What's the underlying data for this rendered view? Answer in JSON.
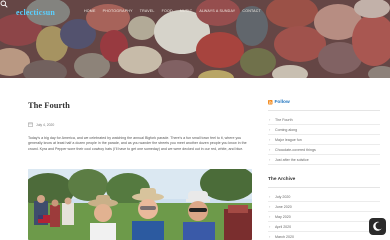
{
  "site": {
    "logo_text": "eclecticsun",
    "menu": [
      "Home",
      "Photography",
      "Travel",
      "Food",
      "Music",
      "Always a Sunday",
      "Contact"
    ]
  },
  "post": {
    "title": "The Fourth",
    "date": "July 4, 2020",
    "body": "Today's a big day for America, and we celebrated by watching the annual Bigfork parade. There's a fun small town feel to it, where you generally know at least half a dozen people in the parade, and as you wander the streets you meet another dozen people you know in the crowd. Kyra and Pepper wore their cool cowboy hats (I'll have to get one someday) and we were decked out in our red, white, and blue.",
    "photo_icon": "group-selfie-photo"
  },
  "sidebar": {
    "follow_title": "Follow",
    "follow_items": [
      "The Fourth",
      "Coming along",
      "Major league fun",
      "Chocolate-covered things",
      "Just after the solstice"
    ],
    "archive_title": "The Archive",
    "archive_items": [
      "July 2020",
      "June 2020",
      "May 2020",
      "April 2020",
      "March 2020"
    ]
  },
  "colors": {
    "logo": "#5ad0ff",
    "accent": "#1e73be",
    "dark_toggle": "#2b2b2b"
  },
  "icons": {
    "rss": "rss-icon",
    "search": "search-icon",
    "calendar": "calendar-icon",
    "toggle": "moon-icon"
  }
}
